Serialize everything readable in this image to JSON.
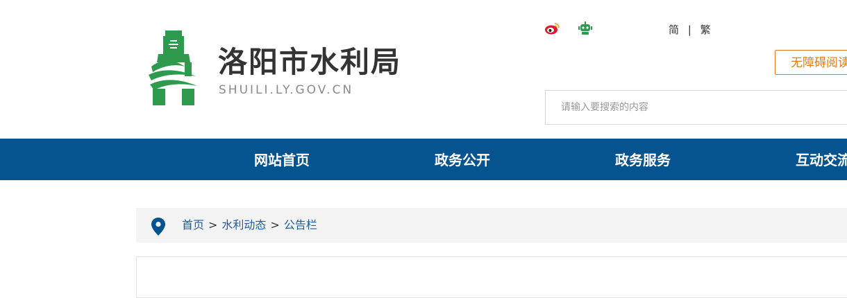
{
  "header": {
    "site_title": "洛阳市水利局",
    "site_domain": "SHUILI.LY.GOV.CN",
    "lang_simplified": "简",
    "lang_separator": "|",
    "lang_traditional": "繁",
    "accessibility_label": "无障碍阅读",
    "search_placeholder": "请输入要搜索的内容",
    "icons": [
      "weibo-icon",
      "robot-icon"
    ]
  },
  "nav": {
    "items": [
      {
        "label": "网站首页"
      },
      {
        "label": "政务公开"
      },
      {
        "label": "政务服务"
      },
      {
        "label": "互动交流"
      }
    ]
  },
  "breadcrumb": {
    "items": [
      {
        "label": "首页"
      },
      {
        "label": "水利动态"
      },
      {
        "label": "公告栏"
      }
    ],
    "separator": ">"
  },
  "colors": {
    "nav_bg": "#06548f",
    "logo_green": "#2e9a4e",
    "accent_orange": "#e07b1a",
    "link_blue": "#1f5c99"
  }
}
